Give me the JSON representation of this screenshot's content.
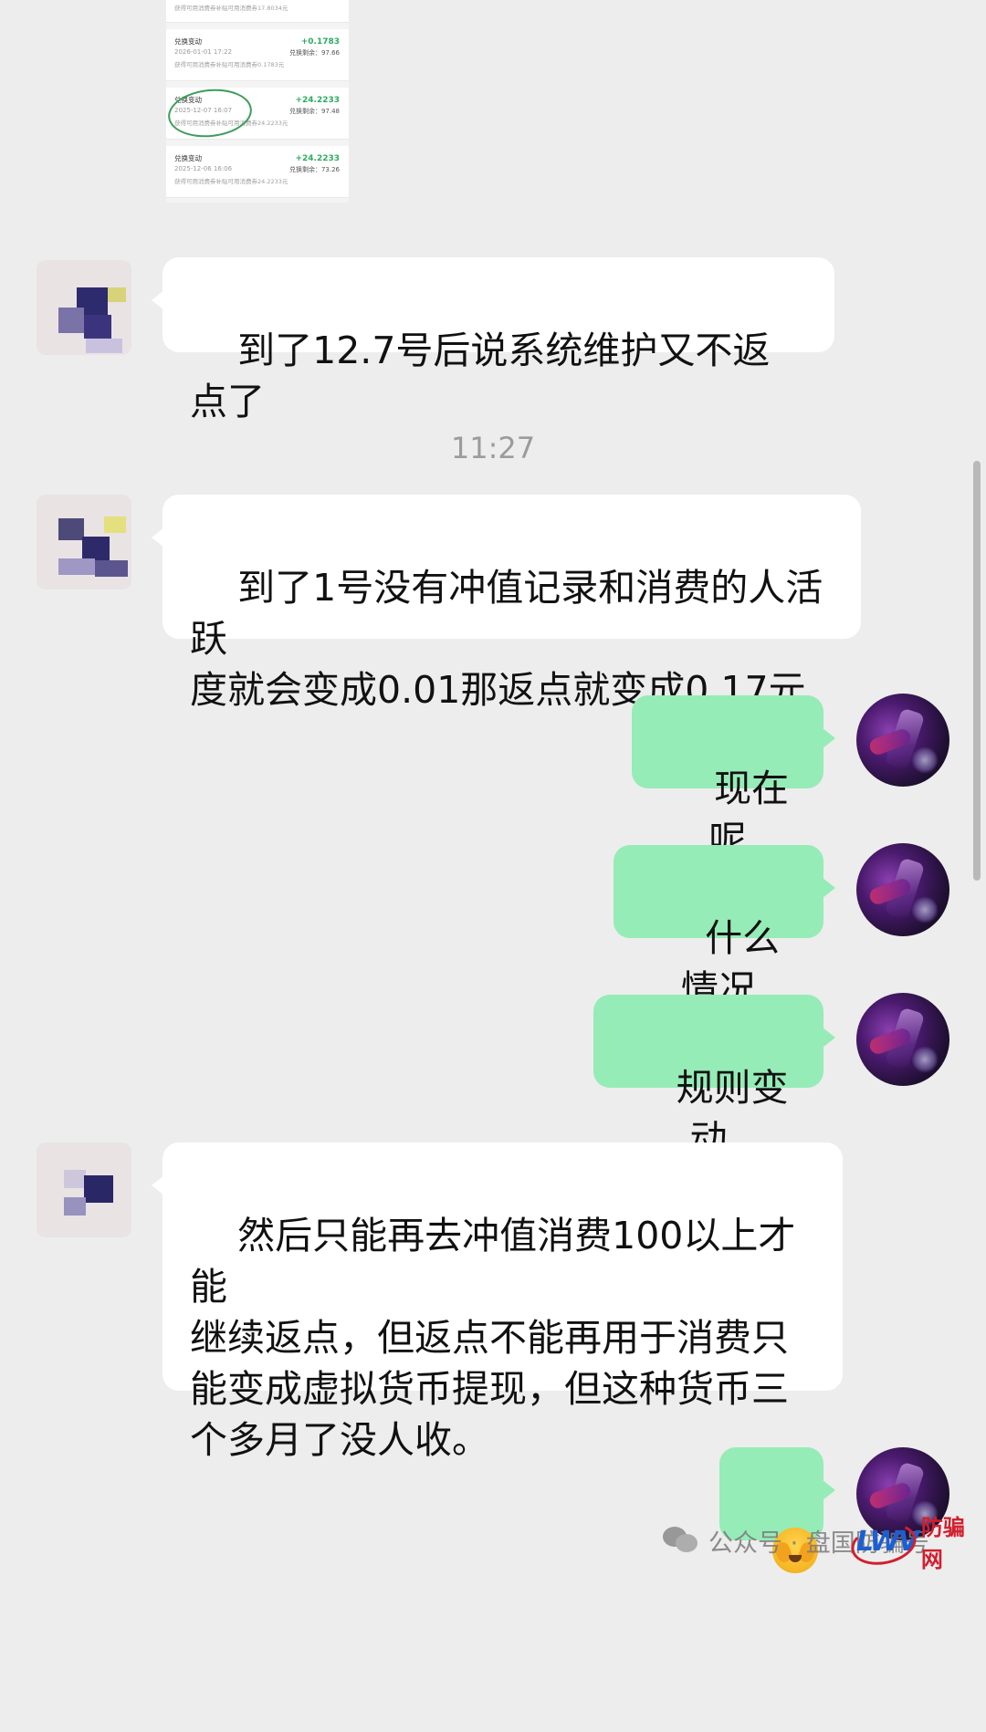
{
  "shared_image": {
    "records": [
      {
        "title": "",
        "time": "",
        "amount": "",
        "remain": "",
        "desc": "获得可用消费券补贴可用消费券17.8034元"
      },
      {
        "title": "兑换变动",
        "time": "2026-01-01 17:22",
        "amount": "+0.1783",
        "remain": "兑换剩余：97.66",
        "desc": "获得可用消费券补贴可用消费券0.1783元"
      },
      {
        "title": "兑换变动",
        "time": "2025-12-07 16:07",
        "amount": "+24.2233",
        "remain": "兑换剩余：97.48",
        "desc": "获得可用消费券补贴可用消费券24.2233元"
      },
      {
        "title": "兑换变动",
        "time": "2025-12-06 16:06",
        "amount": "+24.2233",
        "remain": "兑换剩余：73.26",
        "desc": "获得可用消费券补贴可用消费券24.2233元"
      }
    ]
  },
  "messages": {
    "m1": "到了12.7号后说系统维护又不返点了",
    "timestamp": "11:27",
    "m2": "到了1号没有冲值记录和消费的人活跃\n度就会变成0.01那返点就变成0.17元",
    "m3": "现在呢",
    "m4": "什么情况",
    "m5": "规则变动",
    "m6": "然后只能再去冲值消费100以上才能\n继续返点，但返点不能再用于消费只\n能变成虚拟货币提现，但这种货币三\n个多月了没人收。",
    "m7_emoji": "face-crying-with-hands-emoji"
  },
  "watermark": {
    "text": "公众号 · 盘国防骗号",
    "logo_text": "LWV",
    "logo_cn": "防骗网"
  },
  "colors": {
    "background": "#ededed",
    "incoming_bubble": "#ffffff",
    "outgoing_bubble": "#95ecb7"
  }
}
